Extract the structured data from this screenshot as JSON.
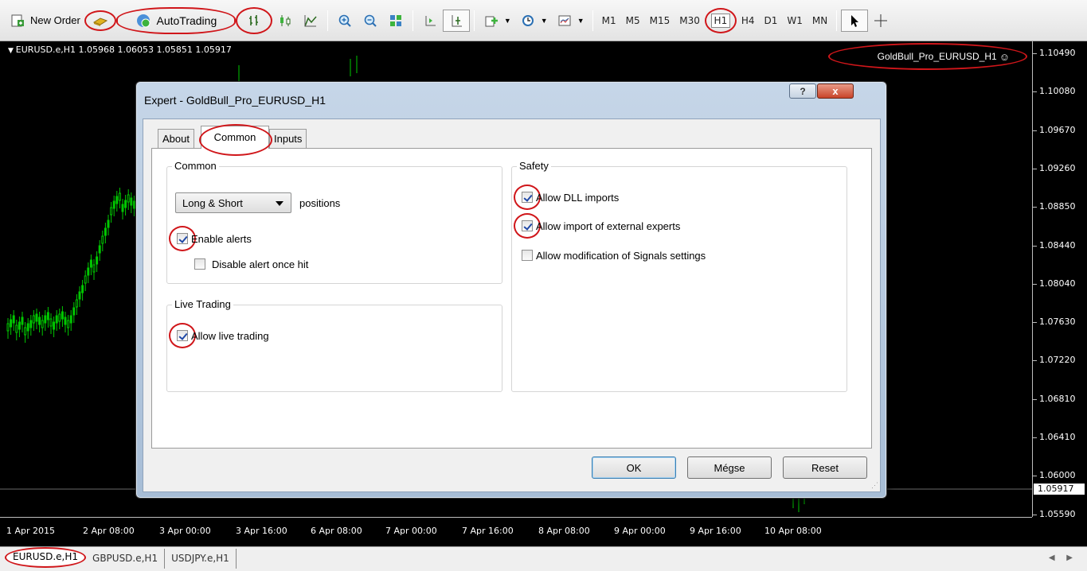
{
  "toolbar": {
    "new_order": "New Order",
    "autotrading": "AutoTrading",
    "timeframes": [
      "M1",
      "M5",
      "M15",
      "M30",
      "H1",
      "H4",
      "D1",
      "W1",
      "MN"
    ],
    "active_timeframe": "H1"
  },
  "chart": {
    "header": "EURUSD.e,H1  1.05968 1.06053 1.05851 1.05917",
    "ea_label": "GoldBull_Pro_EURUSD_H1",
    "ea_icon": "smiley-icon",
    "price_labels": [
      "1.10490",
      "1.10080",
      "1.09670",
      "1.09260",
      "1.08850",
      "1.08440",
      "1.08040",
      "1.07630",
      "1.07220",
      "1.06810",
      "1.06410",
      "1.06000",
      "1.05590"
    ],
    "current_price": "1.05917",
    "time_labels": [
      "1 Apr 2015",
      "2 Apr 08:00",
      "3 Apr 00:00",
      "3 Apr 16:00",
      "6 Apr 08:00",
      "7 Apr 00:00",
      "7 Apr 16:00",
      "8 Apr 08:00",
      "9 Apr 00:00",
      "9 Apr 16:00",
      "10 Apr 08:00"
    ],
    "colors": {
      "bull": "#00c800",
      "bear": "#00c800",
      "background": "#000000"
    }
  },
  "chart_tabs": [
    "EURUSD.e,H1",
    "GBPUSD.e,H1",
    "USDJPY.e,H1"
  ],
  "dialog": {
    "title": "Expert - GoldBull_Pro_EURUSD_H1",
    "help": "?",
    "close": "x",
    "tabs": [
      "About",
      "Common",
      "Inputs"
    ],
    "active_tab": "Common",
    "common_group": {
      "title": "Common",
      "positions_select": "Long & Short",
      "positions_label": "positions",
      "enable_alerts": "Enable alerts",
      "disable_alert_once_hit": "Disable alert once hit"
    },
    "live_group": {
      "title": "Live Trading",
      "allow_live_trading": "Allow live trading"
    },
    "safety_group": {
      "title": "Safety",
      "allow_dll": "Allow DLL imports",
      "allow_import": "Allow import of external experts",
      "allow_signals": "Allow modification of Signals settings"
    },
    "buttons": {
      "ok": "OK",
      "cancel": "Mégse",
      "reset": "Reset"
    }
  }
}
